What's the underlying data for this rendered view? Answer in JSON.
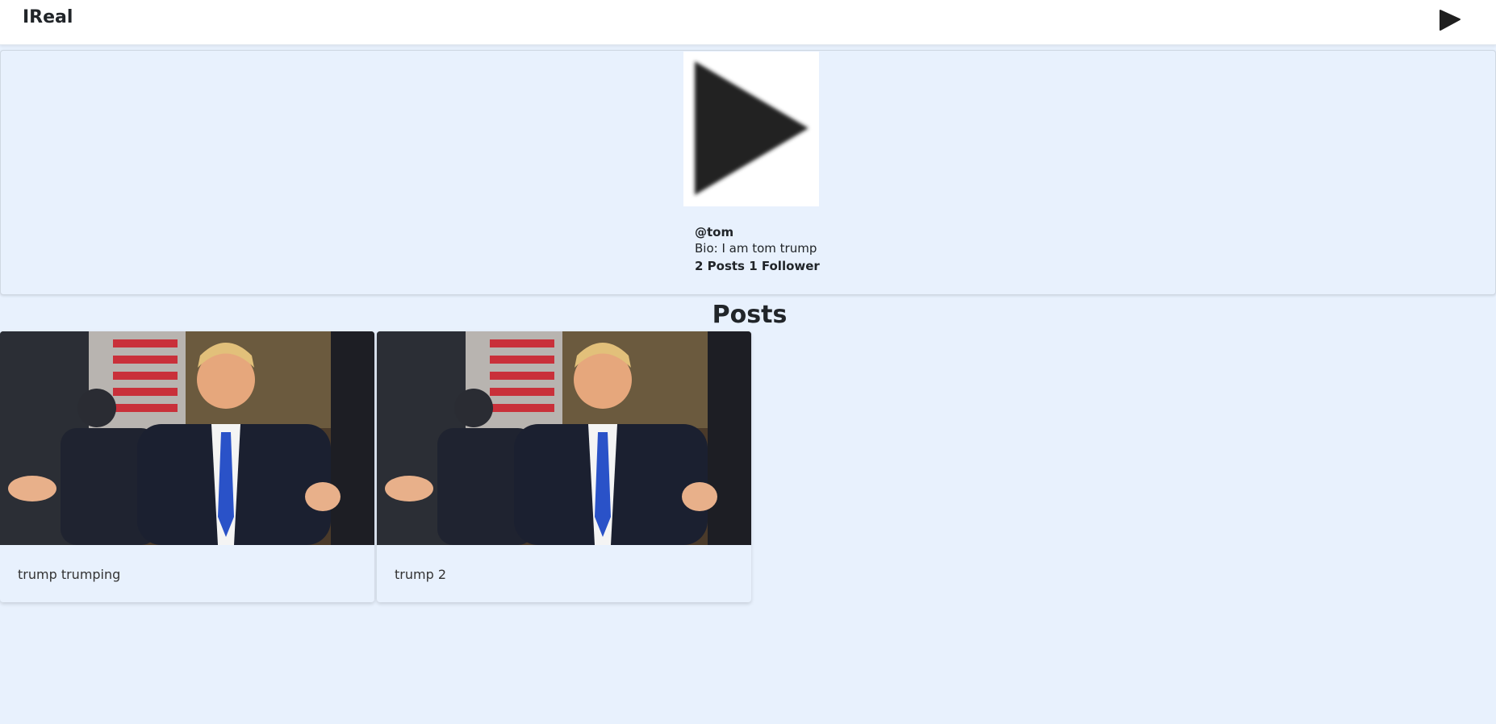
{
  "navbar": {
    "brand": "IReal",
    "avatar_icon": "play-triangle-icon"
  },
  "profile": {
    "picture_icon": "play-triangle-icon",
    "handle": "@tom",
    "bio": "Bio: I am tom trump",
    "stats": "2 Posts 1 Follower"
  },
  "posts_section": {
    "heading": "Posts",
    "items": [
      {
        "caption": "trump trumping"
      },
      {
        "caption": "trump 2"
      }
    ]
  },
  "colors": {
    "page_background": "#e8f1fd",
    "navbar_background": "#ffffff",
    "text": "#212529"
  }
}
